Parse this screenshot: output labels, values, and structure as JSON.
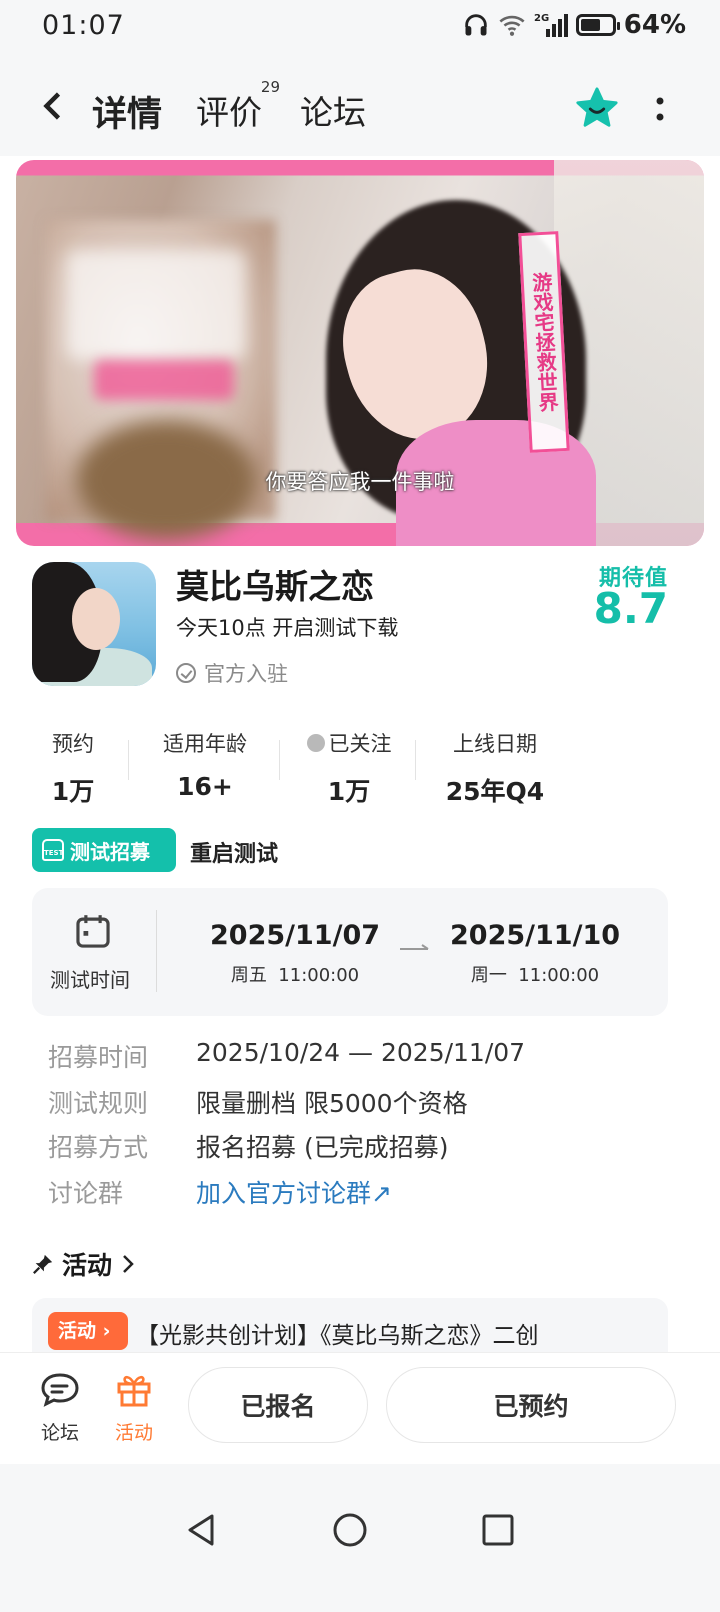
{
  "status_bar": {
    "time": "01:07",
    "battery": "64%",
    "network": "2G",
    "battery_level": 0.64
  },
  "header": {
    "tabs": [
      {
        "label": "详情",
        "active": true
      },
      {
        "label": "评价",
        "badge": "29"
      },
      {
        "label": "论坛"
      }
    ],
    "accent_color": "#16c1ad"
  },
  "banner": {
    "vertical_tag": "游戏宅拯救世界",
    "subtitle": "你要答应我一件事啦"
  },
  "game": {
    "name": "莫比乌斯之恋",
    "subtitle": "今天10点 开启测试下载",
    "official": "官方入驻",
    "expect_label": "期待值",
    "expect_value": "8.7"
  },
  "stats": [
    {
      "label": "预约",
      "value": "1万"
    },
    {
      "label": "适用年龄",
      "value": "16+"
    },
    {
      "label": "已关注",
      "value": "1万"
    },
    {
      "label": "上线日期",
      "value": "25年Q4"
    }
  ],
  "test": {
    "badge": "测试招募",
    "title": "重启测试",
    "time_label": "测试时间",
    "start_date": "2025/11/07",
    "start_time": "周五  11:00:00",
    "end_date": "2025/11/10",
    "end_time": "周一  11:00:00"
  },
  "info": [
    {
      "key": "招募时间",
      "value": "2025/10/24 — 2025/11/07"
    },
    {
      "key": "测试规则",
      "value": "限量删档 限5000个资格"
    },
    {
      "key": "招募方式",
      "value": "报名招募 (已完成招募)"
    },
    {
      "key": "讨论群",
      "value": "加入官方讨论群↗"
    }
  ],
  "activity": {
    "title": "活动",
    "badge": "活动",
    "text": "【光影共创计划】《莫比乌斯之恋》二创"
  },
  "bottom_bar": {
    "forum_label": "论坛",
    "activity_label": "活动",
    "signed_up": "已报名",
    "reserved": "已预约",
    "activity_color": "#ff7a33"
  }
}
